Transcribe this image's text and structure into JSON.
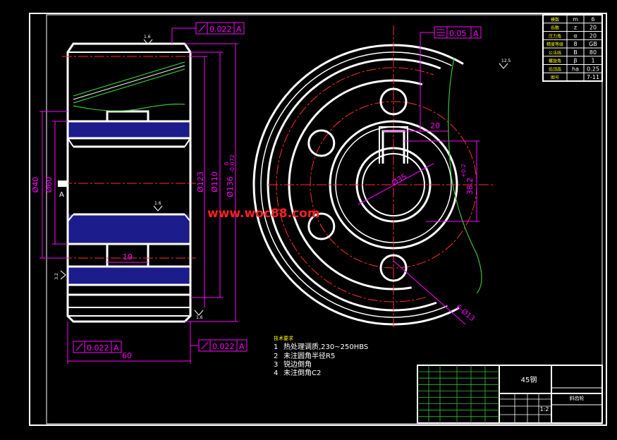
{
  "colors": {
    "bg": "#000000",
    "outline": "#ffffff",
    "dimension": "#ff00ff",
    "center": "#ff3030",
    "hatch": "#1c1c8c",
    "thread": "#39c139",
    "watermark": "#ff2222",
    "table_yellow": "#ffff00"
  },
  "tolerances": {
    "top_left_value": "0.022",
    "top_left_datum": "A",
    "bottom_left_value": "0.022",
    "bottom_left_datum": "A",
    "bottom_right_value": "0.022",
    "bottom_right_datum": "A",
    "right_view_value": "0.05",
    "right_view_datum": "A"
  },
  "dimensions": {
    "d40": "Ø40",
    "d60": "Ø60",
    "d123": "Ø123",
    "d110": "Ø110",
    "d136": "Ø136",
    "d136_tol_upper": "0",
    "d136_tol_lower": "-0.072",
    "width_60": "60",
    "slot_19": "19",
    "keyway_20": "20",
    "d35": "Ø35",
    "key_depth": "38.2",
    "key_depth_tol": "+0.2",
    "d_hole": "6-Ø13",
    "datum_left": "A",
    "roughness_top": "1.6",
    "roughness_mid": "1.6",
    "roughness_left": "3.2",
    "roughness_bottom": "1.6",
    "roughness_corner": "12.5"
  },
  "watermark": "www.woc88.com",
  "notes": {
    "heading": "技术要求",
    "items": [
      {
        "num": "1",
        "text": "热处理调质,230~250HBS"
      },
      {
        "num": "2",
        "text": "未注圆角半径R5"
      },
      {
        "num": "3",
        "text": "锐边倒角"
      },
      {
        "num": "4",
        "text": "未注倒角C2"
      }
    ]
  },
  "param_table": {
    "rows": [
      [
        "模数",
        "m",
        "6"
      ],
      [
        "齿数",
        "z",
        "20"
      ],
      [
        "压力角",
        "α",
        "20"
      ],
      [
        "精度等级",
        "8",
        "GB"
      ],
      [
        "公法线",
        "B",
        "80"
      ],
      [
        "螺旋角",
        "β",
        "1"
      ],
      [
        "齿顶高",
        "ha",
        "0.25"
      ],
      [
        "图号",
        "",
        "7-11"
      ]
    ]
  },
  "title_block": {
    "material": "45钢",
    "part_name": "斜齿轮",
    "scale": "1:2"
  }
}
